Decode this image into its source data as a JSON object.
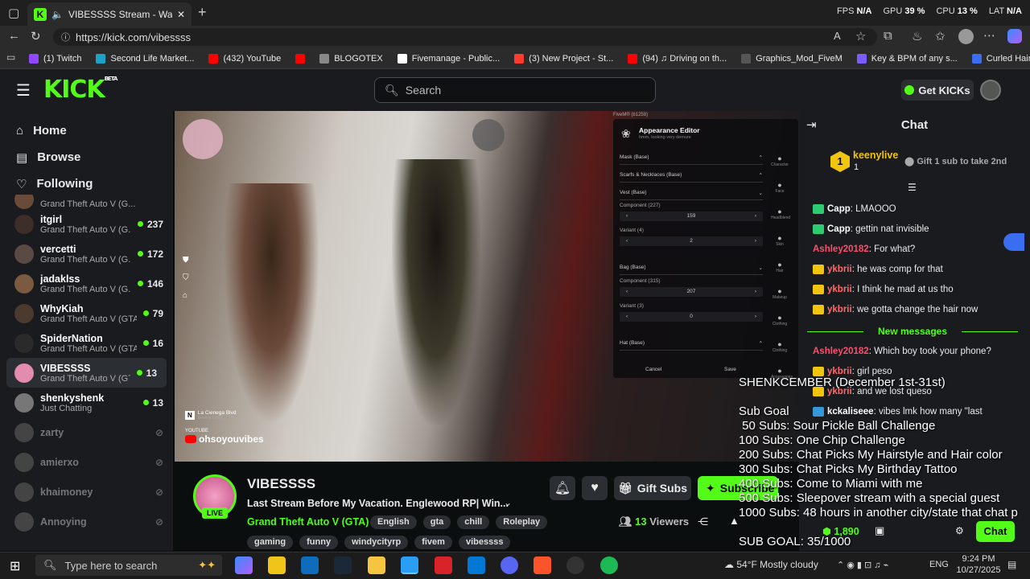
{
  "browser": {
    "tab_title": "VIBESSSS Stream - Watch Li...",
    "url": "https://kick.com/vibessss",
    "perf": [
      {
        "label": "FPS",
        "value": "N/A"
      },
      {
        "label": "GPU",
        "value": "39 %"
      },
      {
        "label": "CPU",
        "value": "13 %"
      },
      {
        "label": "LAT",
        "value": "N/A"
      }
    ],
    "bookmarks": [
      {
        "label": "(1) Twitch",
        "color": "#9146ff"
      },
      {
        "label": "Second Life Market...",
        "color": "#1aa3c7"
      },
      {
        "label": "(432) YouTube",
        "color": "#ff0000"
      },
      {
        "label": "",
        "color": "#ff0000"
      },
      {
        "label": "BLOGOTEX",
        "color": "#888888"
      },
      {
        "label": "Fivemanage - Public...",
        "color": "#ffffff"
      },
      {
        "label": "(3) New Project - St...",
        "color": "#ff3b30"
      },
      {
        "label": "(94) ♫ Driving on th...",
        "color": "#ff0000"
      },
      {
        "label": "Graphics_Mod_FiveM",
        "color": "#555555"
      },
      {
        "label": "Key & BPM of any s...",
        "color": "#7b5cff"
      },
      {
        "label": "Curled Hair W/ Brai...",
        "color": "#3a6df0"
      }
    ]
  },
  "kick": {
    "logo": "KICK",
    "logo_sup": "BETA",
    "search_placeholder": "Search",
    "get_kicks": "Get KICKs"
  },
  "sidebar": {
    "nav": [
      "Home",
      "Browse",
      "Following"
    ],
    "channels": [
      {
        "name": "",
        "game": "Grand Theft Auto V (G...",
        "viewers": "",
        "status": "partial"
      },
      {
        "name": "itgirl",
        "game": "Grand Theft Auto V (G...",
        "viewers": "237",
        "status": "live"
      },
      {
        "name": "vercetti",
        "game": "Grand Theft Auto V (G...",
        "viewers": "172",
        "status": "live"
      },
      {
        "name": "jadaklss",
        "game": "Grand Theft Auto V (G...",
        "viewers": "146",
        "status": "live"
      },
      {
        "name": "WhyKiah",
        "game": "Grand Theft Auto V (GTA)",
        "viewers": "79",
        "status": "live"
      },
      {
        "name": "SpiderNation",
        "game": "Grand Theft Auto V (GTA)",
        "viewers": "16",
        "status": "live"
      },
      {
        "name": "VIBESSSS",
        "game": "Grand Theft Auto V (GTA)",
        "viewers": "13",
        "status": "active"
      },
      {
        "name": "shenkyshenk",
        "game": "Just Chatting",
        "viewers": "13",
        "status": "live"
      },
      {
        "name": "zarty",
        "game": "",
        "viewers": "",
        "status": "off"
      },
      {
        "name": "amierxo",
        "game": "",
        "viewers": "",
        "status": "off"
      },
      {
        "name": "khaimoney",
        "game": "",
        "viewers": "",
        "status": "off"
      },
      {
        "name": "Annoying",
        "game": "",
        "viewers": "",
        "status": "off"
      }
    ]
  },
  "video": {
    "editor": {
      "title": "Appearance Editor",
      "subtitle": "hmm, looking very demure",
      "sections": [
        "Mask (Base)",
        "Scarfs & Necklaces (Base)",
        "Vest (Base)",
        "Bag (Base)",
        "Hat (Base)"
      ],
      "fields": [
        {
          "label": "Component (227)",
          "value": "159"
        },
        {
          "label": "Variant (4)",
          "value": "2"
        },
        {
          "label": "Component (315)",
          "value": "207"
        },
        {
          "label": "Variant (3)",
          "value": "0"
        }
      ],
      "cancel": "Cancel",
      "save": "Save",
      "side_tabs": [
        "Character",
        "Face",
        "Headblend",
        "Skin",
        "Hair",
        "Makeup",
        "Clothing",
        "Clothing",
        "Accessories"
      ]
    },
    "location": "La Cienega Blvd",
    "location_sub": "Beverly Grove",
    "youtube_label": "YOUTUBE",
    "youtube_handle": "ohsoyouvibes",
    "fivem_counter": "FiveM® (b1258)"
  },
  "stream": {
    "channel": "VIBESSSS",
    "live": "LIVE",
    "title": "Last Stream Before My Vacation. Englewood RP| Win...",
    "category": "Grand Theft Auto V (GTA)",
    "tags": [
      "English",
      "gta",
      "chill",
      "Roleplay"
    ],
    "tags2": [
      "gaming",
      "funny",
      "windycityrp",
      "fivem",
      "vibessss"
    ],
    "gift_subs": "Gift Subs",
    "subscribe": "Subscribe",
    "viewers_count": "13",
    "viewers_label": "Viewers"
  },
  "chat": {
    "title": "Chat",
    "pinned_user": "keenylive",
    "pinned_rank": "1",
    "pinned_count": "1",
    "gift_prompt": "Gift 1 sub to take 2nd",
    "messages": [
      {
        "user": "Capp",
        "text": "LMAOOO",
        "color": "#ffffff",
        "badge": "#2ecc71"
      },
      {
        "user": "Capp",
        "text": "gettin nat invisible",
        "color": "#ffffff",
        "badge": "#2ecc71"
      },
      {
        "user": "Ashley20182",
        "text": "For what?",
        "color": "#ff4d6d",
        "badge": ""
      },
      {
        "user": "ykbrii",
        "text": "he was comp for that",
        "color": "#ff6b6b",
        "badge": "#f1c40f"
      },
      {
        "user": "ykbrii",
        "text": "I think he mad at us tho",
        "color": "#ff6b6b",
        "badge": "#f1c40f"
      },
      {
        "user": "ykbrii",
        "text": "we gotta change the hair now",
        "color": "#ff6b6b",
        "badge": "#f1c40f"
      }
    ],
    "new_messages": "New messages",
    "messages2": [
      {
        "user": "Ashley20182",
        "text": "Which boy took your phone?",
        "color": "#ff4d6d",
        "badge": ""
      },
      {
        "user": "ykbrii",
        "text": "girl peso",
        "color": "#ff6b6b",
        "badge": "#f1c40f"
      },
      {
        "user": "ykbrii",
        "text": "and we lost queso",
        "color": "#ff6b6b",
        "badge": "#f1c40f"
      },
      {
        "user": "kckaliseee",
        "text": "vibes lmk how many \"last",
        "color": "#ffffff",
        "badge": "#3498db"
      }
    ],
    "coins": "1,890",
    "chat_button": "Chat"
  },
  "overlay": {
    "lines": [
      "SHENKCEMBER (December 1st-31st)",
      "",
      "Sub Goal",
      " 50 Subs: Sour Pickle Ball Challenge",
      "100 Subs: One Chip Challenge",
      "200 Subs: Chat Picks My Hairstyle and Hair color",
      "300 Subs: Chat Picks My Birthday Tattoo",
      "400 Subs: Come to Miami with me",
      "500 Subs: Sleepover stream with a special guest",
      "1000 Subs: 48 hours in another city/state that chat p",
      "",
      "SUB GOAL: 35/1000"
    ]
  },
  "taskbar": {
    "search_placeholder": "Type here to search",
    "weather": "54°F  Mostly cloudy",
    "lang": "ENG",
    "time": "9:24 PM",
    "date": "10/27/2025"
  }
}
